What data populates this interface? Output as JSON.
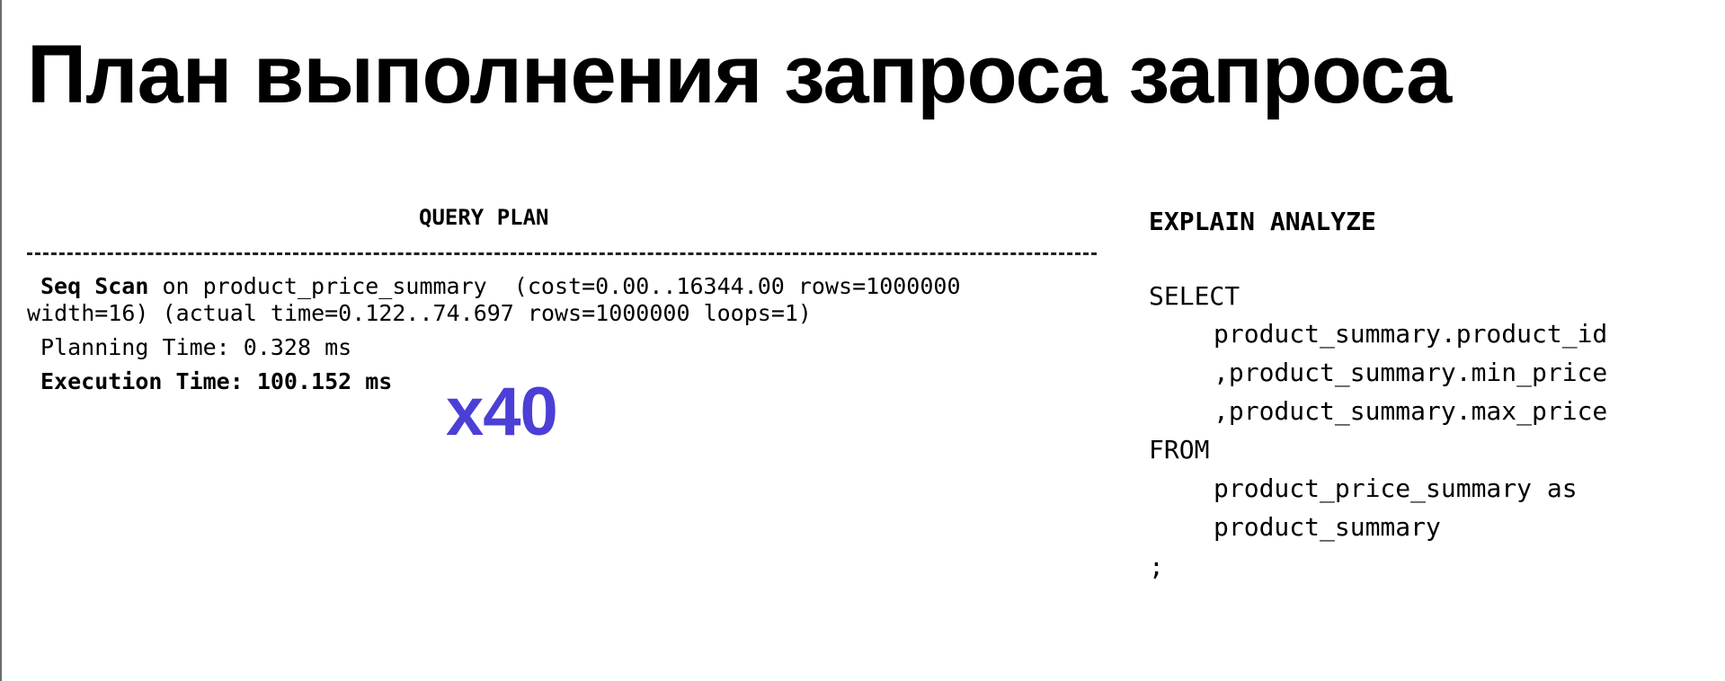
{
  "title": "План выполнения запроса запроса",
  "query_plan": {
    "header": "QUERY PLAN",
    "line1_bold": "Seq Scan",
    "line1_rest": " on product_price_summary  (cost=0.00..16344.00 rows=1000000",
    "line2": "width=16) (actual time=0.122..74.697 rows=1000000 loops=1)",
    "planning_time": "Planning Time: 0.328 ms",
    "execution_time": "Execution Time: 100.152 ms"
  },
  "speedup": "x40",
  "sql": {
    "header": "EXPLAIN ANALYZE",
    "lines": [
      "SELECT",
      "product_summary.product_id",
      ",product_summary.min_price",
      ",product_summary.max_price",
      "FROM",
      "product_price_summary as",
      "product_summary",
      ";"
    ]
  },
  "colors": {
    "accent": "#4b3fd6",
    "text": "#000000",
    "background": "#ffffff"
  }
}
